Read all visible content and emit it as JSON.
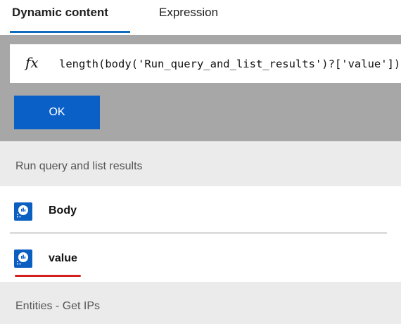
{
  "tabs": {
    "dynamic_label": "Dynamic content",
    "expression_label": "Expression"
  },
  "expression": {
    "fx_symbol": "fx",
    "value": "length(body('Run_query_and_list_results')?['value'])"
  },
  "ok_button": {
    "label": "OK"
  },
  "sections": [
    {
      "title": "Run query and list results",
      "items": [
        {
          "label": "Body",
          "icon": "log-analytics-icon"
        },
        {
          "label": "value",
          "icon": "log-analytics-icon",
          "highlighted": true
        }
      ]
    },
    {
      "title": "Entities - Get IPs"
    }
  ],
  "colors": {
    "accent": "#0f6cbd",
    "ok_button": "#0b60c8",
    "panel_gray": "#a7a7a7",
    "section_bg": "#ebebeb",
    "highlight_red": "#d41f1f",
    "icon_blue": "#0b5fc0"
  }
}
